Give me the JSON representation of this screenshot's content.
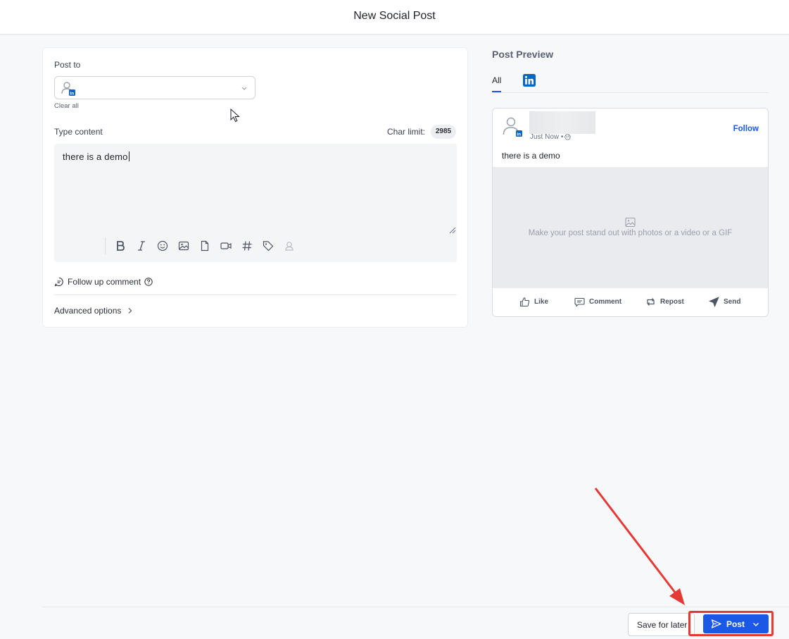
{
  "header": {
    "title": "New Social Post"
  },
  "composer": {
    "post_to_label": "Post to",
    "clear_all": "Clear all",
    "type_content_label": "Type content",
    "char_limit_label": "Char limit:",
    "char_limit_value": "2985",
    "content": "there is a demo",
    "toolbar_icons": [
      "bold-icon",
      "italic-icon",
      "emoji-icon",
      "image-icon",
      "document-icon",
      "video-icon",
      "hashtag-icon",
      "tag-icon",
      "mention-icon"
    ],
    "follow_up_label": "Follow up comment",
    "advanced_label": "Advanced options"
  },
  "preview": {
    "title": "Post Preview",
    "tabs": {
      "all": "All"
    },
    "meta": "Just Now •",
    "follow": "Follow",
    "text": "there is a demo",
    "media_hint": "Make your post stand out with photos or a video or a GIF",
    "actions": {
      "like": "Like",
      "comment": "Comment",
      "repost": "Repost",
      "send": "Send"
    }
  },
  "footer": {
    "save_label": "Save for later",
    "post_label": "Post"
  },
  "colors": {
    "accent": "#1b58e6",
    "linkedin": "#0a66c2",
    "annotation": "#e53935"
  }
}
